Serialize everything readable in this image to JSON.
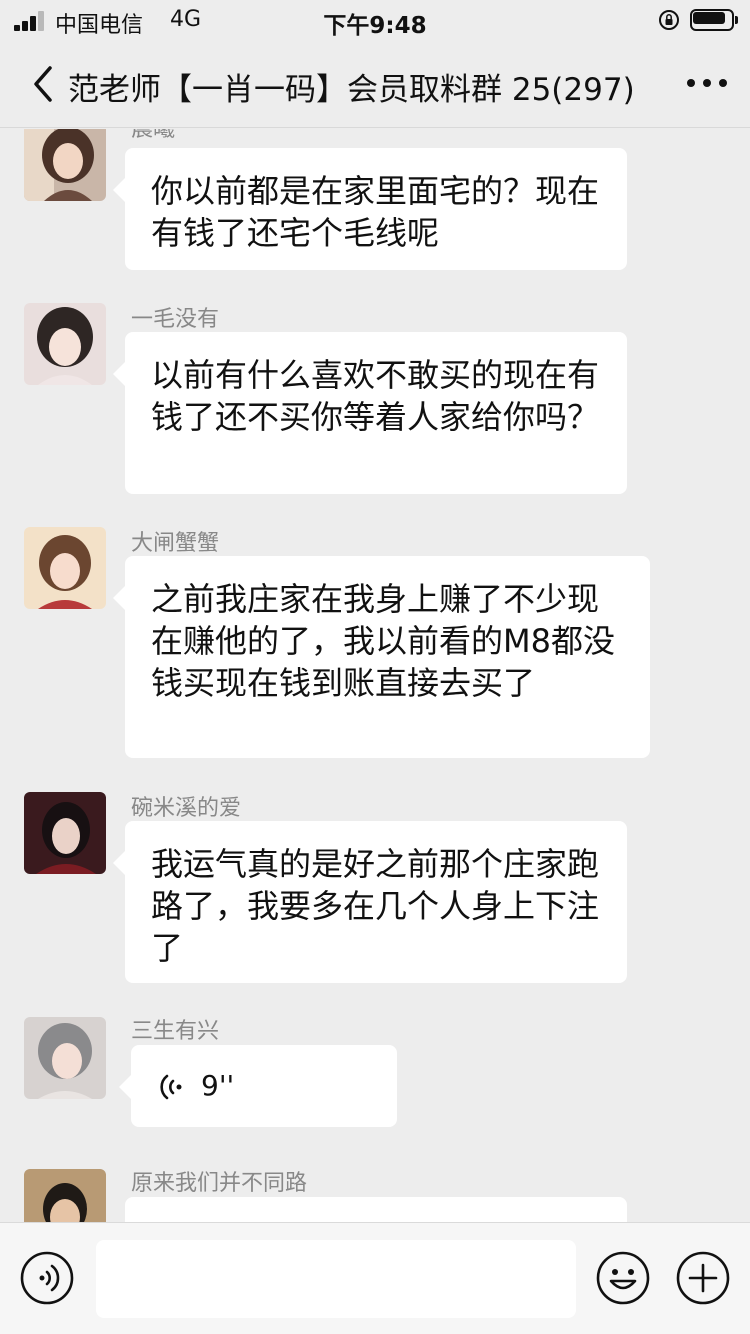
{
  "status_bar": {
    "carrier": "中国电信",
    "network": "4G",
    "time": "下午9:48",
    "battery_level": 0.85
  },
  "nav": {
    "title": "范老师【一肖一码】会员取料群 25(297)",
    "back_icon": "chevron-left-icon",
    "more_icon": "more-dots-icon"
  },
  "messages": [
    {
      "sender": "晨曦",
      "text": "你以前都是在家里面宅的？现在有钱了还宅个毛线呢"
    },
    {
      "sender": "一毛没有",
      "text": "以前有什么喜欢不敢买的现在有钱了还不买你等着人家给你吗？"
    },
    {
      "sender": "大闸蟹蟹",
      "text": "之前我庄家在我身上赚了不少现在赚他的了，我以前看的M8都没钱买现在钱到账直接去买了"
    },
    {
      "sender": "碗米溪的爱",
      "text": "我运气真的是好之前那个庄家跑路了，我要多在几个人身上下注了"
    },
    {
      "sender": "三生有兴",
      "voice_duration": "9''"
    },
    {
      "sender": "原来我们并不同路",
      "text": ""
    }
  ],
  "input_bar": {
    "voice_icon": "voice-input-icon",
    "emoji_icon": "emoji-icon",
    "plus_icon": "plus-icon",
    "input_value": ""
  }
}
